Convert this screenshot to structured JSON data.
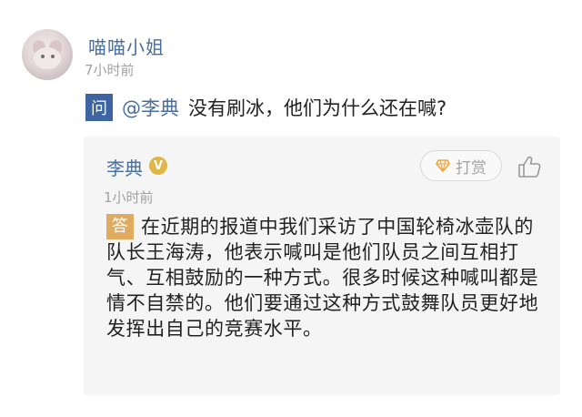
{
  "post": {
    "username": "喵喵小姐",
    "time": "7小时前",
    "question_badge": "问",
    "mention": "@李典",
    "question": "没有刷冰，他们为什么还在喊?"
  },
  "answer": {
    "name": "李典",
    "verified_badge": "V",
    "tip_label": "打赏",
    "time": "1小时前",
    "answer_badge": "答",
    "text": "在近期的报道中我们采访了中国轮椅冰壶队的队长王海涛，他表示喊叫是他们队员之间互相打气、互相鼓励的一种方式。很多时候这种喊叫都是情不自禁的。他们要通过这种方式鼓舞队员更好地发挥出自己的竞赛水平。"
  },
  "icons": {
    "tip": "gem-icon",
    "like": "thumbs-up-icon"
  },
  "colors": {
    "username": "#4a6e9c",
    "question_badge": "#3e64a4",
    "answer_badge": "#e1ab5f",
    "verified": "#e0b647",
    "card_bg": "#f5f5f5"
  }
}
